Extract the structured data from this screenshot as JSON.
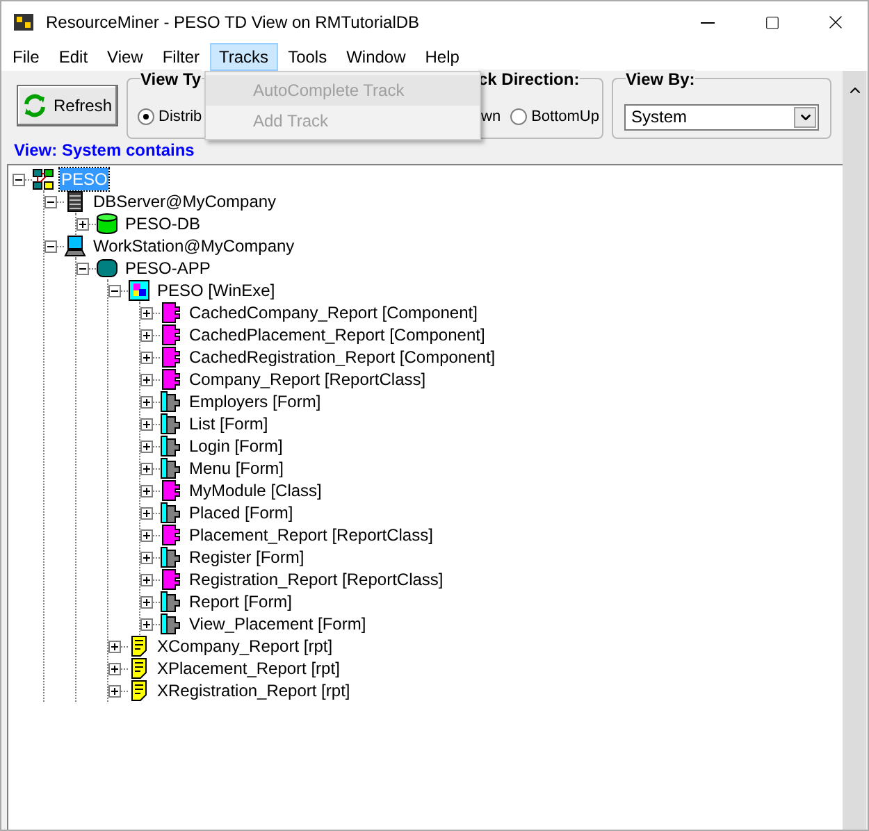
{
  "window": {
    "title": "ResourceMiner - PESO TD View on RMTutorialDB"
  },
  "menu": [
    {
      "label": "File",
      "selected": false
    },
    {
      "label": "Edit",
      "selected": false
    },
    {
      "label": "View",
      "selected": false
    },
    {
      "label": "Filter",
      "selected": false
    },
    {
      "label": "Tracks",
      "selected": true
    },
    {
      "label": "Tools",
      "selected": false
    },
    {
      "label": "Window",
      "selected": false
    },
    {
      "label": "Help",
      "selected": false
    }
  ],
  "dropdown": [
    {
      "label": "AutoComplete Track",
      "disabled": true,
      "highlighted": true
    },
    {
      "label": "Add Track",
      "disabled": true,
      "highlighted": false
    }
  ],
  "toolbar": {
    "refresh": "Refresh",
    "view_type": {
      "legend": "View Ty",
      "options": [
        {
          "label": "Distrib",
          "selected": true
        }
      ]
    },
    "direction": {
      "legend": "ck Direction:",
      "cut_label": "wn",
      "options": [
        {
          "label": "BottomUp",
          "selected": false
        }
      ]
    },
    "view_by": {
      "legend": "View By:",
      "value": "System"
    }
  },
  "view_label": "View: System contains",
  "tree": [
    {
      "label": "PESO",
      "kind": "network",
      "expanded": true,
      "selected": true,
      "children": [
        {
          "label": "DBServer@MyCompany",
          "kind": "server",
          "expanded": true,
          "selected": false,
          "children": [
            {
              "label": "PESO-DB",
              "kind": "database",
              "expanded": false,
              "selected": false
            }
          ]
        },
        {
          "label": "WorkStation@MyCompany",
          "kind": "workstation",
          "expanded": true,
          "selected": false,
          "children": [
            {
              "label": "PESO-APP",
              "kind": "app",
              "expanded": true,
              "selected": false,
              "children": [
                {
                  "label": "PESO [WinExe]",
                  "kind": "exe",
                  "expanded": true,
                  "selected": false,
                  "children": [
                    {
                      "label": "CachedCompany_Report [Component]",
                      "kind": "component",
                      "expanded": false,
                      "selected": false
                    },
                    {
                      "label": "CachedPlacement_Report [Component]",
                      "kind": "component",
                      "expanded": false,
                      "selected": false
                    },
                    {
                      "label": "CachedRegistration_Report [Component]",
                      "kind": "component",
                      "expanded": false,
                      "selected": false
                    },
                    {
                      "label": "Company_Report [ReportClass]",
                      "kind": "component",
                      "expanded": false,
                      "selected": false
                    },
                    {
                      "label": "Employers [Form]",
                      "kind": "form",
                      "expanded": false,
                      "selected": false
                    },
                    {
                      "label": "List [Form]",
                      "kind": "form",
                      "expanded": false,
                      "selected": false
                    },
                    {
                      "label": "Login [Form]",
                      "kind": "form",
                      "expanded": false,
                      "selected": false
                    },
                    {
                      "label": "Menu [Form]",
                      "kind": "form",
                      "expanded": false,
                      "selected": false
                    },
                    {
                      "label": "MyModule [Class]",
                      "kind": "component",
                      "expanded": false,
                      "selected": false
                    },
                    {
                      "label": "Placed [Form]",
                      "kind": "form",
                      "expanded": false,
                      "selected": false
                    },
                    {
                      "label": "Placement_Report [ReportClass]",
                      "kind": "component",
                      "expanded": false,
                      "selected": false
                    },
                    {
                      "label": "Register [Form]",
                      "kind": "form",
                      "expanded": false,
                      "selected": false
                    },
                    {
                      "label": "Registration_Report [ReportClass]",
                      "kind": "component",
                      "expanded": false,
                      "selected": false
                    },
                    {
                      "label": "Report [Form]",
                      "kind": "form",
                      "expanded": false,
                      "selected": false
                    },
                    {
                      "label": "View_Placement [Form]",
                      "kind": "form",
                      "expanded": false,
                      "selected": false
                    }
                  ]
                },
                {
                  "label": "XCompany_Report [rpt]",
                  "kind": "report",
                  "expanded": false,
                  "selected": false
                },
                {
                  "label": "XPlacement_Report [rpt]",
                  "kind": "report",
                  "expanded": false,
                  "selected": false
                },
                {
                  "label": "XRegistration_Report [rpt]",
                  "kind": "report",
                  "expanded": false,
                  "selected": false
                }
              ]
            }
          ]
        }
      ]
    }
  ]
}
